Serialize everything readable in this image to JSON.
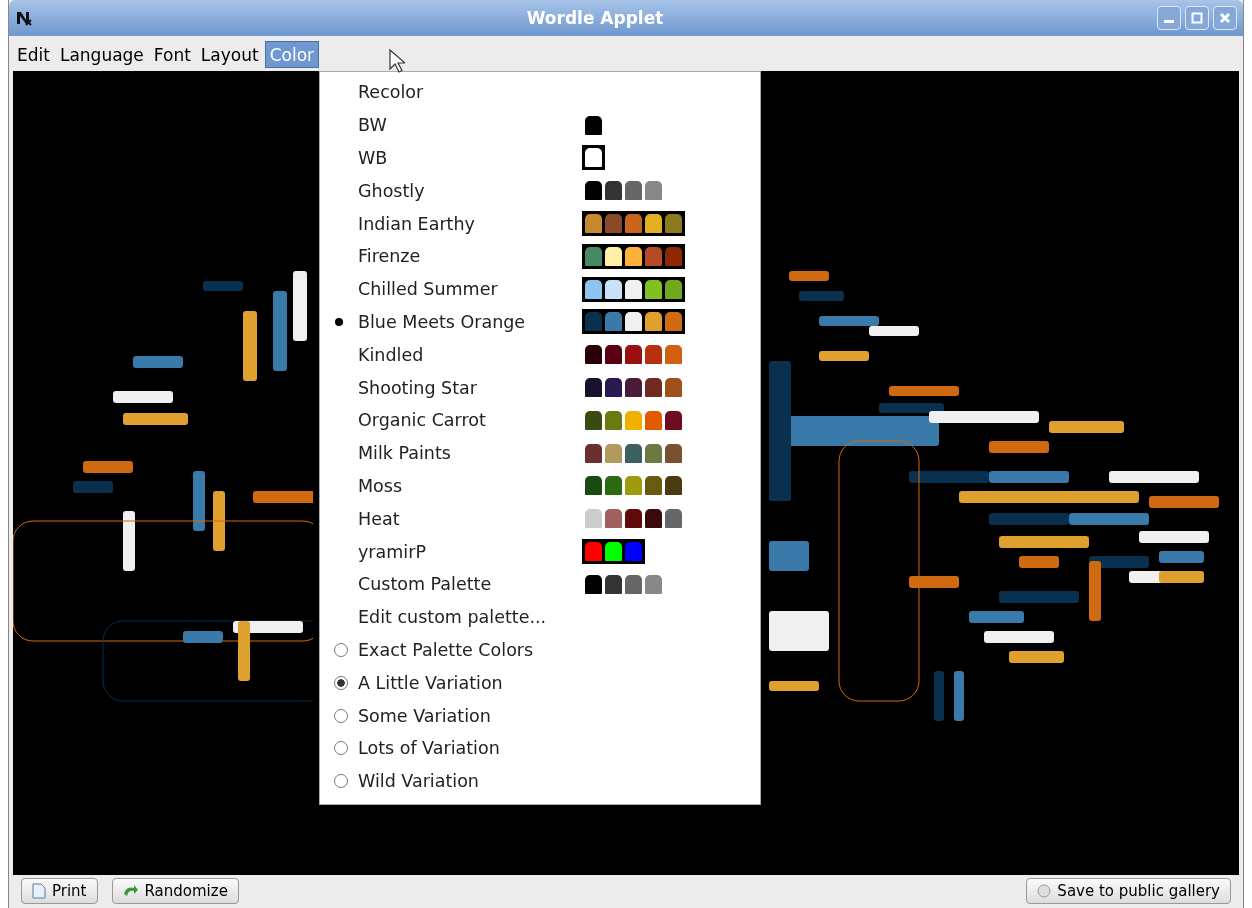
{
  "window": {
    "title": "Wordle Applet"
  },
  "menu_bar": [
    {
      "label": "Edit",
      "selected": false
    },
    {
      "label": "Language",
      "selected": false
    },
    {
      "label": "Font",
      "selected": false
    },
    {
      "label": "Layout",
      "selected": false
    },
    {
      "label": "Color",
      "selected": true
    }
  ],
  "color_menu": {
    "items": [
      {
        "kind": "action",
        "label": "Recolor"
      },
      {
        "kind": "palette",
        "label": "BW",
        "selected": false,
        "framed": false,
        "swatches": [
          {
            "color": "#000000"
          }
        ]
      },
      {
        "kind": "palette",
        "label": "WB",
        "selected": false,
        "framed": true,
        "swatches": [
          {
            "color": "#ffffff"
          }
        ]
      },
      {
        "kind": "palette",
        "label": "Ghostly",
        "selected": false,
        "framed": false,
        "swatches": [
          {
            "color": "#000000"
          },
          {
            "color": "#333333"
          },
          {
            "color": "#666666"
          },
          {
            "color": "#888888"
          }
        ]
      },
      {
        "kind": "palette",
        "label": "Indian Earthy",
        "selected": false,
        "framed": true,
        "swatches": [
          {
            "color": "#c8882e"
          },
          {
            "color": "#8a4a2a"
          },
          {
            "color": "#c8641e"
          },
          {
            "color": "#e0b020"
          },
          {
            "color": "#8a7a1e"
          }
        ]
      },
      {
        "kind": "palette",
        "label": "Firenze",
        "selected": false,
        "framed": true,
        "swatches": [
          {
            "color": "#468966"
          },
          {
            "color": "#fff0a5"
          },
          {
            "color": "#ffb03b"
          },
          {
            "color": "#b64926"
          },
          {
            "color": "#8e2800"
          }
        ]
      },
      {
        "kind": "palette",
        "label": "Chilled Summer",
        "selected": false,
        "framed": true,
        "swatches": [
          {
            "color": "#8ec4f0"
          },
          {
            "color": "#c8e0f8"
          },
          {
            "color": "#f0f0f0"
          },
          {
            "color": "#80c020"
          },
          {
            "color": "#70a820"
          }
        ]
      },
      {
        "kind": "palette",
        "label": "Blue Meets Orange",
        "selected": true,
        "framed": true,
        "swatches": [
          {
            "color": "#0a3050"
          },
          {
            "color": "#3a7aaa"
          },
          {
            "color": "#f0f0f0"
          },
          {
            "color": "#e0a030"
          },
          {
            "color": "#d06a10"
          }
        ]
      },
      {
        "kind": "palette",
        "label": "Kindled",
        "selected": false,
        "framed": false,
        "swatches": [
          {
            "color": "#2a0008"
          },
          {
            "color": "#5a0010"
          },
          {
            "color": "#9a1010"
          },
          {
            "color": "#b83010"
          },
          {
            "color": "#d06010"
          }
        ]
      },
      {
        "kind": "palette",
        "label": "Shooting Star",
        "selected": false,
        "framed": false,
        "swatches": [
          {
            "color": "#1a1030"
          },
          {
            "color": "#2a1a50"
          },
          {
            "color": "#4a1a3a"
          },
          {
            "color": "#702a20"
          },
          {
            "color": "#a0501a"
          }
        ]
      },
      {
        "kind": "palette",
        "label": "Organic Carrot",
        "selected": false,
        "framed": false,
        "swatches": [
          {
            "color": "#3a4a10"
          },
          {
            "color": "#6a7a10"
          },
          {
            "color": "#f0b000"
          },
          {
            "color": "#e05a00"
          },
          {
            "color": "#700a20"
          }
        ]
      },
      {
        "kind": "palette",
        "label": "Milk Paints",
        "selected": false,
        "framed": false,
        "swatches": [
          {
            "color": "#6a3030"
          },
          {
            "color": "#b09a60"
          },
          {
            "color": "#3a6060"
          },
          {
            "color": "#6a7a40"
          },
          {
            "color": "#7a5030"
          }
        ]
      },
      {
        "kind": "palette",
        "label": "Moss",
        "selected": false,
        "framed": false,
        "swatches": [
          {
            "color": "#1a4a10"
          },
          {
            "color": "#2a6a10"
          },
          {
            "color": "#a09a10"
          },
          {
            "color": "#6a5a10"
          },
          {
            "color": "#4a3a10"
          }
        ]
      },
      {
        "kind": "palette",
        "label": "Heat",
        "selected": false,
        "framed": false,
        "swatches": [
          {
            "color": "#cccccc"
          },
          {
            "color": "#a06060"
          },
          {
            "color": "#600a0a"
          },
          {
            "color": "#3a0a0a"
          },
          {
            "color": "#666666"
          }
        ]
      },
      {
        "kind": "palette",
        "label": "yramirP",
        "selected": false,
        "framed": true,
        "swatches": [
          {
            "color": "#ff0000"
          },
          {
            "color": "#00ff00"
          },
          {
            "color": "#0000ff"
          }
        ]
      },
      {
        "kind": "palette",
        "label": "Custom Palette",
        "selected": false,
        "framed": false,
        "swatches": [
          {
            "color": "#000000"
          },
          {
            "color": "#333333"
          },
          {
            "color": "#666666"
          },
          {
            "color": "#888888"
          }
        ]
      },
      {
        "kind": "action",
        "label": "Edit custom palette..."
      },
      {
        "kind": "radio",
        "label": "Exact Palette Colors",
        "selected": false
      },
      {
        "kind": "radio",
        "label": "A Little Variation",
        "selected": true
      },
      {
        "kind": "radio",
        "label": "Some Variation",
        "selected": false
      },
      {
        "kind": "radio",
        "label": "Lots of Variation",
        "selected": false
      },
      {
        "kind": "radio",
        "label": "Wild Variation",
        "selected": false
      }
    ]
  },
  "buttons": [
    {
      "label": "Print",
      "kind": "print"
    },
    {
      "label": "Randomize",
      "kind": "randomize"
    },
    {
      "label": "Save to public gallery",
      "kind": "save"
    }
  ]
}
